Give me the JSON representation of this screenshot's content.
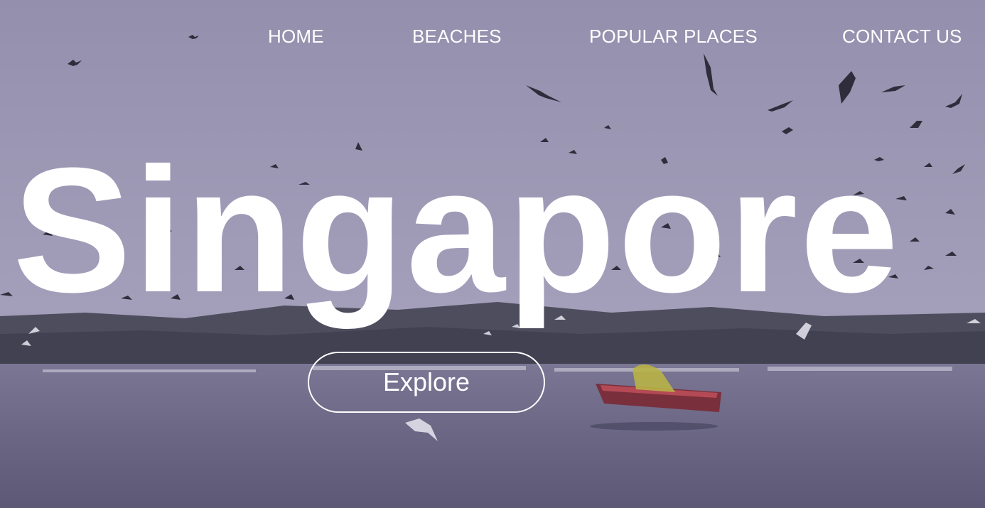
{
  "nav": {
    "items": [
      {
        "label": "HOME"
      },
      {
        "label": "BEACHES"
      },
      {
        "label": "POPULAR PLACES"
      },
      {
        "label": "CONTACT US"
      }
    ]
  },
  "hero": {
    "title": "Singapore",
    "button_label": "Explore",
    "background_description_colors": {
      "sky_top": "#9a97b5",
      "sky_horizon": "#a6a2bc",
      "treeline": "#4a4a58",
      "water": "#6f6b88",
      "text": "#ffffff"
    }
  }
}
